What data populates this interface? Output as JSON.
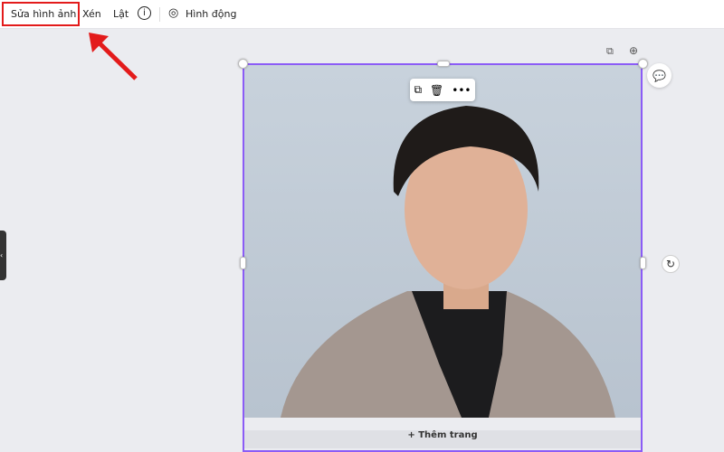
{
  "toolbar": {
    "edit_image": "Sửa hình ảnh",
    "crop": "Xén",
    "flip": "Lật",
    "info": "i",
    "animate": "Hình động"
  },
  "canvas": {
    "add_page": "+ Thêm trang"
  },
  "colors": {
    "selection": "#8b5cf6",
    "highlight": "#e31b1b"
  }
}
